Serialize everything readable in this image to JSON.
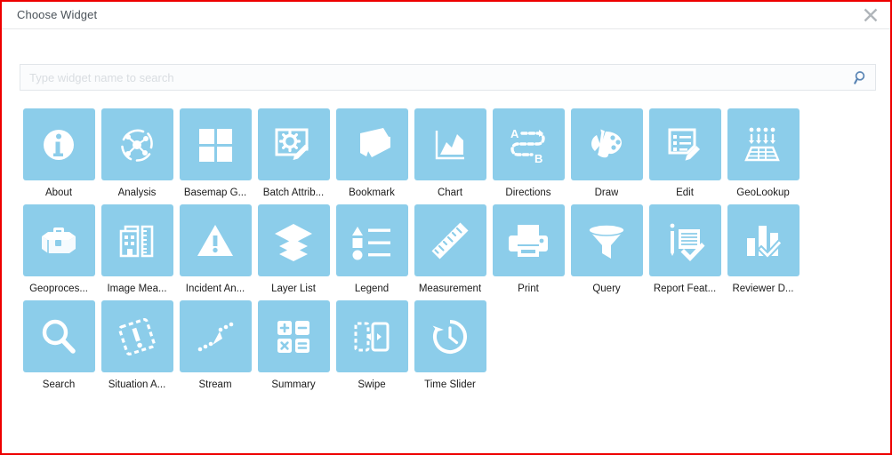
{
  "dialog": {
    "title": "Choose Widget",
    "close_icon": "close-icon"
  },
  "search": {
    "placeholder": "Type widget name to search",
    "value": "",
    "icon": "search-icon"
  },
  "colors": {
    "tile_blue": "#8ccdea",
    "dialog_border_red": "#ee0000",
    "title_text": "#4a5259",
    "label_text": "#1b1b1b",
    "search_icon_blue": "#5b86b5",
    "close_icon_gray": "#b0b5ba"
  },
  "widgets": [
    {
      "label": "About",
      "icon": "info-icon"
    },
    {
      "label": "Analysis",
      "icon": "analysis-network-icon"
    },
    {
      "label": "Basemap G...",
      "icon": "basemap-grid-icon"
    },
    {
      "label": "Batch Attrib...",
      "icon": "batch-attribute-gear-pencil-icon"
    },
    {
      "label": "Bookmark",
      "icon": "bookmark-book-icon"
    },
    {
      "label": "Chart",
      "icon": "chart-area-icon"
    },
    {
      "label": "Directions",
      "icon": "directions-a-to-b-icon"
    },
    {
      "label": "Draw",
      "icon": "draw-palette-icon"
    },
    {
      "label": "Edit",
      "icon": "edit-list-pencil-icon"
    },
    {
      "label": "GeoLookup",
      "icon": "geolookup-arrows-table-icon"
    },
    {
      "label": "Geoproces...",
      "icon": "geoprocessing-toolbox-icon"
    },
    {
      "label": "Image Mea...",
      "icon": "image-measurement-building-ruler-icon"
    },
    {
      "label": "Incident An...",
      "icon": "incident-warning-triangle-icon"
    },
    {
      "label": "Layer List",
      "icon": "layer-stack-icon"
    },
    {
      "label": "Legend",
      "icon": "legend-symbols-icon"
    },
    {
      "label": "Measurement",
      "icon": "measurement-ruler-icon"
    },
    {
      "label": "Print",
      "icon": "print-printer-icon"
    },
    {
      "label": "Query",
      "icon": "query-funnel-icon"
    },
    {
      "label": "Report Feat...",
      "icon": "report-document-pen-check-icon"
    },
    {
      "label": "Reviewer D...",
      "icon": "reviewer-barchart-check-icon"
    },
    {
      "label": "Search",
      "icon": "search-magnifier-icon"
    },
    {
      "label": "Situation A...",
      "icon": "situation-awareness-dashed-alert-icon"
    },
    {
      "label": "Stream",
      "icon": "stream-dotted-arrow-icon"
    },
    {
      "label": "Summary",
      "icon": "summary-calculator-icon"
    },
    {
      "label": "Swipe",
      "icon": "swipe-panel-arrows-icon"
    },
    {
      "label": "Time Slider",
      "icon": "time-slider-clock-icon"
    }
  ]
}
